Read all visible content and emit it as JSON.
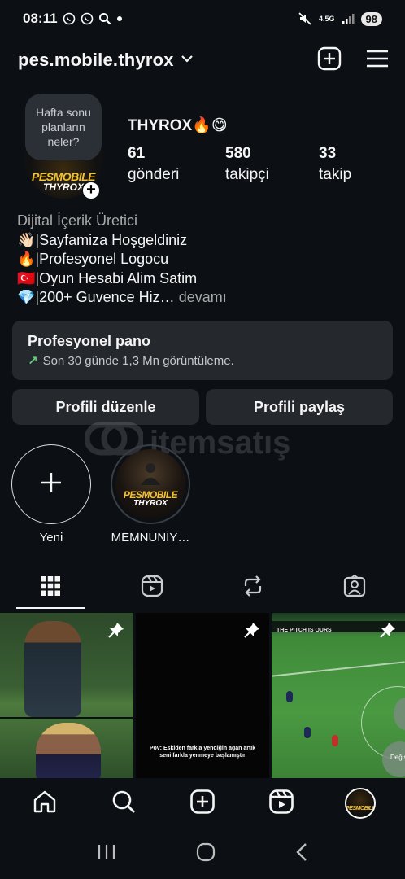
{
  "status_bar": {
    "time": "08:11",
    "network": "4.5G",
    "battery": "98"
  },
  "header": {
    "username": "pes.mobile.thyrox"
  },
  "profile": {
    "note_bubble": "Hafta sonu planların neler?",
    "avatar_logo_line1": "PESMOBILE",
    "avatar_logo_line2": "THYROX",
    "display_name": "THYROX🔥😋",
    "stats": [
      {
        "value": "61",
        "label": "gönderi"
      },
      {
        "value": "580",
        "label": "takipçi"
      },
      {
        "value": "33",
        "label": "takip"
      }
    ]
  },
  "bio": {
    "category": "Dijital İçerik Üretici",
    "lines": [
      "👋🏻|Sayfamiza Hoşgeldiniz",
      "🔥|Profesyonel Logocu",
      "🇹🇷|Oyun Hesabi Alim Satim",
      "💎|200+ Guvence Hiz…"
    ],
    "more": "devamı"
  },
  "pro_panel": {
    "title": "Profesyonel pano",
    "subtitle": "Son 30 günde 1,3 Mn görüntüleme."
  },
  "buttons": {
    "edit_profile": "Profili düzenle",
    "share_profile": "Profili paylaş"
  },
  "watermark": "itemsatış",
  "highlights": [
    {
      "label": "Yeni"
    },
    {
      "label": "MEMNUNİY…",
      "logo_line1": "PESMOBILE",
      "logo_line2": "THYROX"
    }
  ],
  "grid": {
    "post2_caption": "Pov: Eskiden farkla yendiğin agan artık seni farkla yenmeye başlamıştır",
    "post3_bar": "THE PITCH IS OURS",
    "post3_button": "Değiş"
  },
  "colors": {
    "background": "#0c1014",
    "panel": "#25292e",
    "trend_green": "#5fd07a",
    "logo_gold": "#f2c230"
  }
}
